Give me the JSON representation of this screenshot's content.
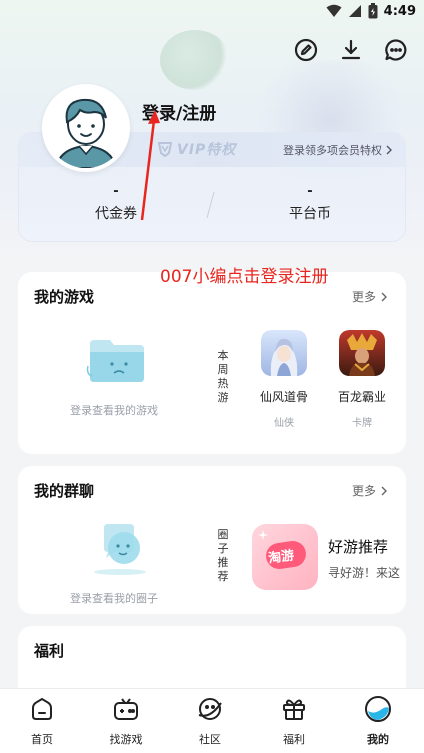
{
  "status": {
    "time": "4:49"
  },
  "profile": {
    "login_label": "登录/注册"
  },
  "vip": {
    "badge": "VIP特权",
    "link": "登录领多项会员特权"
  },
  "stats": [
    {
      "value": "-",
      "label": "代金券"
    },
    {
      "value": "-",
      "label": "平台币"
    }
  ],
  "annotation": "007小编点击登录注册",
  "my_games": {
    "title": "我的游戏",
    "more": "更多",
    "empty_text": "登录查看我的游戏",
    "side_label": "本周热游",
    "items": [
      {
        "name": "仙风道骨",
        "tag": "仙侠"
      },
      {
        "name": "百龙霸业",
        "tag": "卡牌"
      }
    ]
  },
  "my_groups": {
    "title": "我的群聊",
    "more": "更多",
    "empty_text": "登录查看我的圈子",
    "side_label": "圈子推荐",
    "rec_logo": "淘游",
    "rec_title": "好游推荐",
    "rec_desc": "寻好游！来这"
  },
  "welfare": {
    "title": "福利"
  },
  "tabs": [
    {
      "label": "首页",
      "icon": "home-icon"
    },
    {
      "label": "找游戏",
      "icon": "gamepad-icon"
    },
    {
      "label": "社区",
      "icon": "planet-icon"
    },
    {
      "label": "福利",
      "icon": "gift-icon"
    },
    {
      "label": "我的",
      "icon": "profile-icon"
    }
  ]
}
